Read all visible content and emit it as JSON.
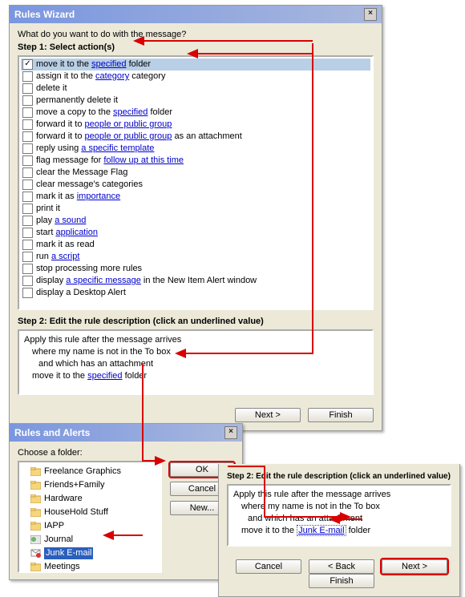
{
  "wizard": {
    "title": "Rules Wizard",
    "prompt": "What do you want to do with the message?",
    "step1_label": "Step 1: Select action(s)",
    "actions": [
      {
        "pre": "move it to the ",
        "link": "specified",
        "post": " folder",
        "checked": true,
        "selected": true
      },
      {
        "pre": "assign it to the ",
        "link": "category",
        "post": " category"
      },
      {
        "pre": "delete it"
      },
      {
        "pre": "permanently delete it"
      },
      {
        "pre": "move a copy to the ",
        "link": "specified",
        "post": " folder"
      },
      {
        "pre": "forward it to ",
        "link": "people or public group"
      },
      {
        "pre": "forward it to ",
        "link": "people or public group",
        "post": " as an attachment"
      },
      {
        "pre": "reply using ",
        "link": "a specific template"
      },
      {
        "pre": "flag message for ",
        "link": "follow up at this time"
      },
      {
        "pre": "clear the Message Flag"
      },
      {
        "pre": "clear message's categories"
      },
      {
        "pre": "mark it as ",
        "link": "importance"
      },
      {
        "pre": "print it"
      },
      {
        "pre": "play ",
        "link": "a sound"
      },
      {
        "pre": "start ",
        "link": "application"
      },
      {
        "pre": "mark it as read"
      },
      {
        "pre": "run ",
        "link": "a script"
      },
      {
        "pre": "stop processing more rules"
      },
      {
        "pre": "display ",
        "link": "a specific message",
        "post": " in the New Item Alert window"
      },
      {
        "pre": "display a Desktop Alert"
      }
    ],
    "step2_label": "Step 2: Edit the rule description (click an underlined value)",
    "desc": {
      "l1": "Apply this rule after the message arrives",
      "l2": "where my name is not in the To box",
      "l3": "and which has an attachment",
      "l4_pre": "move it to the ",
      "l4_link": "specified",
      "l4_post": " folder"
    },
    "buttons": {
      "next": "Next >",
      "finish": "Finish"
    }
  },
  "folderdlg": {
    "title": "Rules and Alerts",
    "choose": "Choose a folder:",
    "folders": [
      {
        "name": "Freelance Graphics",
        "icon": "folder"
      },
      {
        "name": "Friends+Family",
        "icon": "folder"
      },
      {
        "name": "Hardware",
        "icon": "folder"
      },
      {
        "name": "HouseHold Stuff",
        "icon": "folder"
      },
      {
        "name": "IAPP",
        "icon": "folder"
      },
      {
        "name": "Journal",
        "icon": "journal"
      },
      {
        "name": "Junk E-mail",
        "icon": "junk",
        "selected": true
      },
      {
        "name": "Meetings",
        "icon": "folder"
      }
    ],
    "buttons": {
      "ok": "OK",
      "cancel": "Cancel",
      "new": "New..."
    }
  },
  "bottompanel": {
    "step2_label": "Step 2: Edit the rule description (click an underlined value)",
    "desc": {
      "l1": "Apply this rule after the message arrives",
      "l2": "where my name is not in the To box",
      "l3": "and which has an attachment",
      "l4_pre": "move it to the ",
      "l4_link": "Junk E-mail",
      "l4_post": " folder"
    },
    "buttons": {
      "cancel": "Cancel",
      "back": "< Back",
      "next": "Next >",
      "finish": "Finish"
    }
  }
}
